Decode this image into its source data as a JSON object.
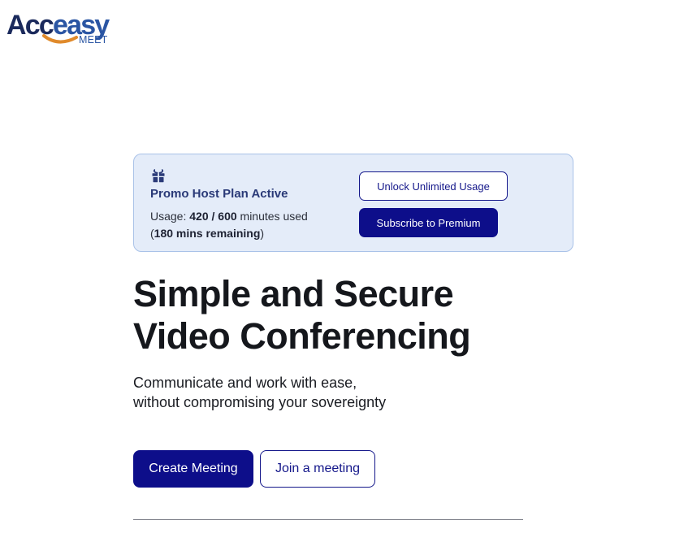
{
  "brand": {
    "logo_part1": "Acc",
    "logo_part2": "easy",
    "logo_sub": "MEET",
    "colors": {
      "dark": "#1b2a5c",
      "blue": "#2a55a3",
      "smile": "#e08a2b"
    }
  },
  "promo": {
    "icon": "gift-icon",
    "title": "Promo Host Plan Active",
    "usage_prefix": "Usage: ",
    "usage_value": "420 / 600",
    "usage_suffix": " minutes used",
    "remaining_open": "(",
    "remaining_value": "180 mins remaining",
    "remaining_close": ")",
    "unlock_label": "Unlock Unlimited Usage",
    "subscribe_label": "Subscribe to Premium",
    "colors": {
      "background": "#e4ecf9",
      "border": "#a9c2e8",
      "accent": "#0d0e8a"
    }
  },
  "hero": {
    "title_line1": "Simple and Secure",
    "title_line2": "Video Conferencing",
    "subtitle_line1": "Communicate and work with ease,",
    "subtitle_line2": "without compromising your sovereignty"
  },
  "actions": {
    "create_label": "Create Meeting",
    "join_label": "Join a meeting"
  }
}
